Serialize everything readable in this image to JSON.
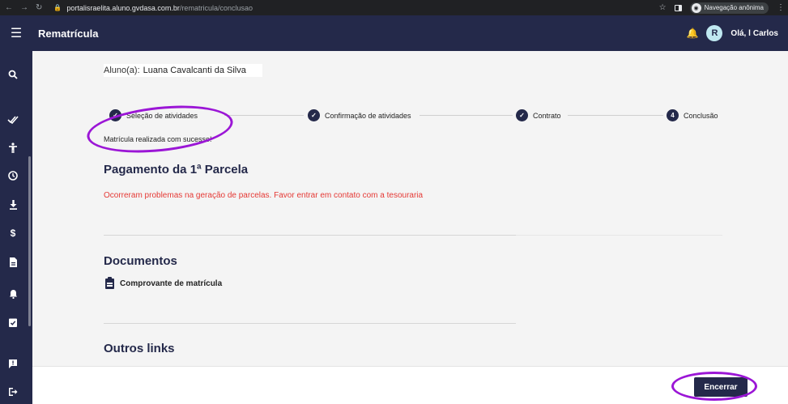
{
  "browser": {
    "url_host": "portalisraelita.aluno.gvdasa.com.br",
    "url_path": "/rematricula/conclusao",
    "incognito_label": "Navegação anônima"
  },
  "appbar": {
    "title": "Rematrícula",
    "greeting": "Olá, l",
    "user_name": "Carlos",
    "avatar_letter": "R"
  },
  "sidebar": {
    "icons": [
      "search-icon",
      "double-check-icon",
      "person-icon",
      "clock-icon",
      "download-icon",
      "dollar-icon",
      "document-icon",
      "bell-icon",
      "clipboard-check-icon",
      "feedback-icon",
      "logout-icon"
    ]
  },
  "student": {
    "label": "Aluno(a):",
    "name": "Luana Cavalcanti da Silva"
  },
  "stepper": {
    "steps": [
      {
        "label": "Seleção de atividades",
        "state": "done"
      },
      {
        "label": "Confirmação de atividades",
        "state": "done"
      },
      {
        "label": "Contrato",
        "state": "done"
      },
      {
        "label": "Conclusão",
        "number": "4",
        "state": "current"
      }
    ]
  },
  "messages": {
    "success": "Matrícula realizada com sucesso!",
    "error": "Ocorreram problemas na geração de parcelas. Favor entrar em contato com a tesouraria"
  },
  "sections": {
    "payment_title": "Pagamento da 1ª Parcela",
    "documents_title": "Documentos",
    "document_link": "Comprovante de matrícula",
    "other_links_title": "Outros links"
  },
  "footer": {
    "end_button": "Encerrar"
  },
  "colors": {
    "primary": "#24294a",
    "error": "#e53935",
    "annotation": "#9b16d6"
  }
}
